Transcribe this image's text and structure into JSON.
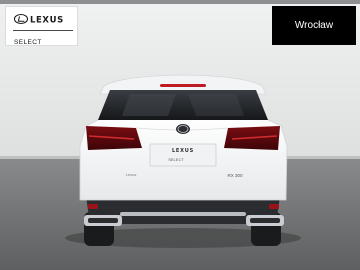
{
  "dealer": {
    "brand": "LEXUS",
    "program": "SELECT",
    "location": "Wrocław"
  },
  "vehicle": {
    "trunk_badge": "LEXUS",
    "plate_label": "SELECT",
    "model_badge": "RX 300",
    "color": "#f6f7f8"
  }
}
